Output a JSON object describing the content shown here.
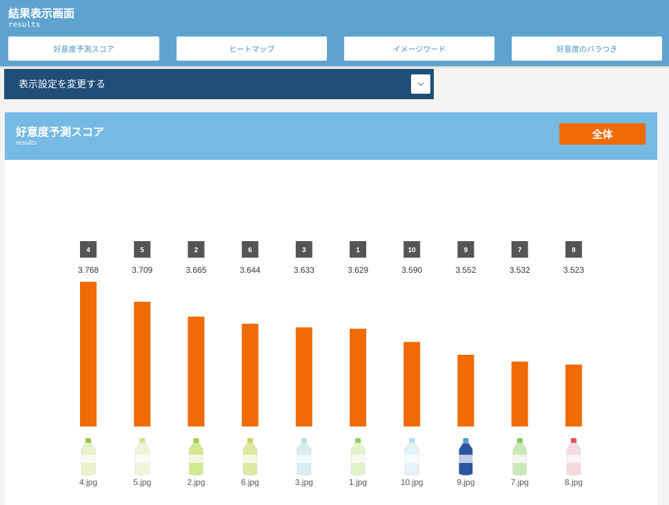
{
  "header": {
    "title": "結果表示画面",
    "subtitle": "results",
    "nav": [
      {
        "label": "好意度予測スコア"
      },
      {
        "label": "ヒートマップ"
      },
      {
        "label": "イメージワード"
      },
      {
        "label": "好意度のバラつき"
      }
    ]
  },
  "settings": {
    "label": "表示設定を変更する",
    "toggle_icon": "chevron-down-icon"
  },
  "panel": {
    "title": "好意度予測スコア",
    "subtitle": "results",
    "filter_label": "全体"
  },
  "colors": {
    "header_bg": "#5ea3cf",
    "settings_bg": "#1f4e77",
    "panel_header_bg": "#76b9e3",
    "accent": "#f06a05",
    "rank_badge_bg": "#555555"
  },
  "chart_data": {
    "type": "bar",
    "categories": [
      "4.jpg",
      "5.jpg",
      "2.jpg",
      "6.jpg",
      "3.jpg",
      "1.jpg",
      "10.jpg",
      "9.jpg",
      "7.jpg",
      "8.jpg"
    ],
    "ranks": [
      "4",
      "5",
      "2",
      "6",
      "3",
      "1",
      "10",
      "9",
      "7",
      "8"
    ],
    "values": [
      3.768,
      3.709,
      3.665,
      3.644,
      3.633,
      3.629,
      3.59,
      3.552,
      3.532,
      3.523
    ],
    "value_labels": [
      "3.768",
      "3.709",
      "3.665",
      "3.644",
      "3.633",
      "3.629",
      "3.590",
      "3.552",
      "3.532",
      "3.523"
    ],
    "ylim": [
      3.34,
      3.768
    ],
    "grid": false,
    "bar_color": "#f06a05"
  }
}
